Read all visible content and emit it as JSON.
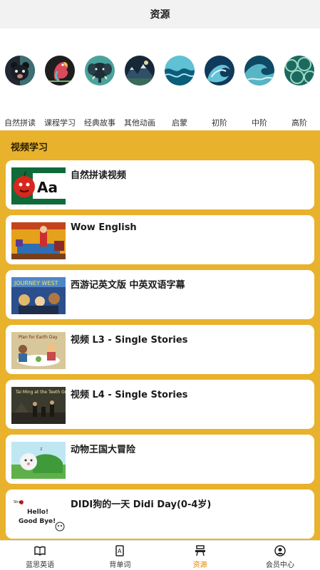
{
  "header": {
    "title": "资源"
  },
  "categories": [
    {
      "label": "自然拼读",
      "icon": "bear-face-icon",
      "bg": "#222831",
      "accent": "#4c8f89"
    },
    {
      "label": "课程学习",
      "icon": "parrot-icon",
      "bg": "#1e1e1e",
      "accent": "#d94a5b"
    },
    {
      "label": "经典故事",
      "icon": "elephant-icon",
      "bg": "#1f2e36",
      "accent": "#49a39c"
    },
    {
      "label": "其他动画",
      "icon": "mountain-landscape-icon",
      "bg": "#162838",
      "accent": "#7fb6c9"
    },
    {
      "label": "启蒙",
      "icon": "wave-icon",
      "bg": "#0c5d7a",
      "accent": "#7fd0e0"
    },
    {
      "label": "初阶",
      "icon": "wave-curl-icon",
      "bg": "#103a5c",
      "accent": "#63c3d6"
    },
    {
      "label": "中阶",
      "icon": "wave-crest-icon",
      "bg": "#0e4a63",
      "accent": "#58b5c6"
    },
    {
      "label": "高阶",
      "icon": "waves-pattern-icon",
      "bg": "#1c6a5f",
      "accent": "#9ad8c4"
    }
  ],
  "section": {
    "title": "视频学习"
  },
  "videos": [
    {
      "title": "自然拼读视频",
      "thumb": "apple-letters-thumbnail"
    },
    {
      "title": "Wow English",
      "thumb": "stage-teacher-thumbnail"
    },
    {
      "title": "西游记英文版 中英双语字幕",
      "thumb": "monkey-king-thumbnail"
    },
    {
      "title": "视频 L3 - Single Stories",
      "thumb": "family-dinner-thumbnail"
    },
    {
      "title": "视频 L4 - Single Stories",
      "thumb": "village-night-thumbnail"
    },
    {
      "title": "动物王国大冒险",
      "thumb": "sleeping-animal-thumbnail"
    },
    {
      "title": "DIDI狗的一天 Didi Day(0-4岁)",
      "thumb": "hello-goodbye-thumbnail"
    }
  ],
  "tabs": [
    {
      "label": "蓝思英语",
      "icon": "book-open-icon",
      "active": false
    },
    {
      "label": "背单词",
      "icon": "word-card-icon",
      "active": false
    },
    {
      "label": "资源",
      "icon": "resource-stack-icon",
      "active": true
    },
    {
      "label": "会员中心",
      "icon": "user-circle-icon",
      "active": false
    }
  ],
  "colors": {
    "accent": "#e9b22d",
    "active_tab": "#e08a00"
  }
}
